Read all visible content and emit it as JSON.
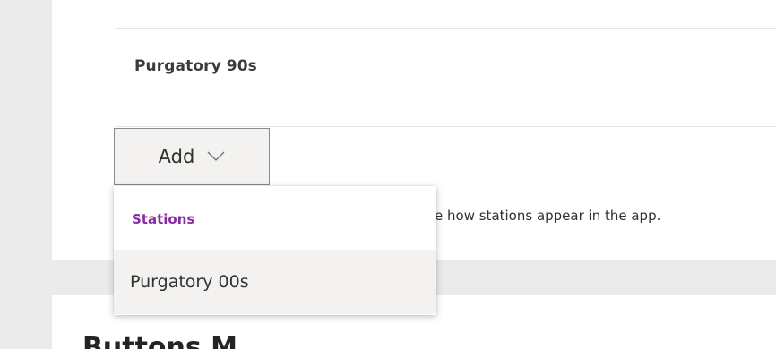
{
  "stations_list": {
    "items": [
      "Purgatory 90s"
    ]
  },
  "add_control": {
    "label": "Add",
    "chevron_icon": "chevron-down-icon"
  },
  "helper_text": "nge how stations appear in the app.",
  "dropdown": {
    "group_header": "Stations",
    "options": [
      "Purgatory 00s"
    ]
  },
  "next_section": {
    "heading": "Buttons M"
  },
  "colors": {
    "accent": "#8a2ba6",
    "page_background": "#ebebeb",
    "card_background": "#ffffff",
    "hover_background": "#f3f2f1",
    "text": "#323130"
  }
}
